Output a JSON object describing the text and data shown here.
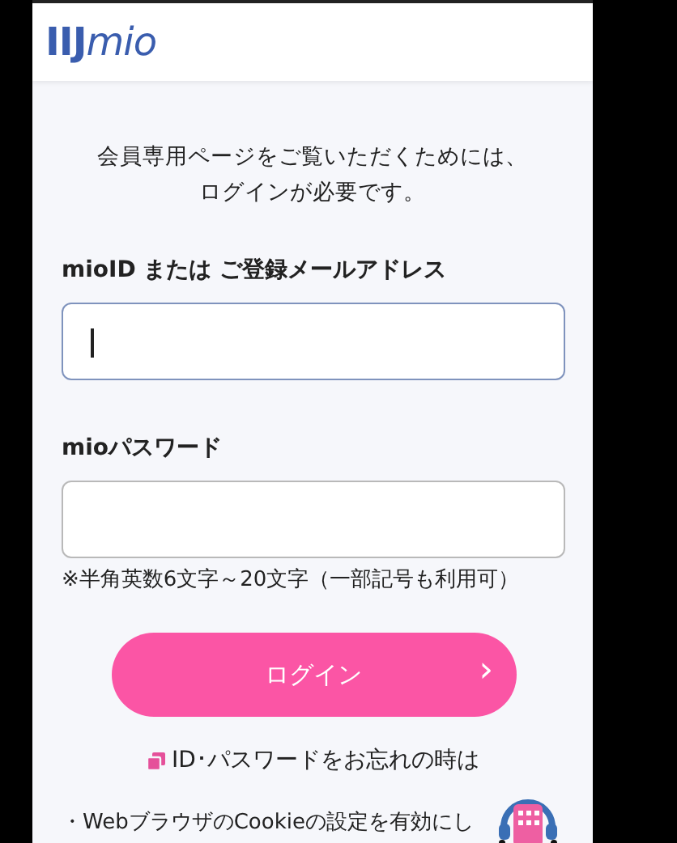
{
  "header": {
    "logo": "**IIJ**mio"
  },
  "intro": [
    "会員専用ページをご覧いただくためには、",
    "ログインが必要です。"
  ],
  "fields": [
    {
      "label": "mioID または ご登録メールアドレス",
      "focused": true
    },
    {
      "label": "mioパスワード",
      "focused": false,
      "hint": "※半角英数6文字～20文字（一部記号も利用可）"
    }
  ],
  "login_button": {
    "label": "ログイン",
    "chevron": "›"
  },
  "forgot_link": "ID･パスワードをお忘れの時は",
  "notes": [
    "・WebブラウザのCookieの設定を有効にし"
  ]
}
